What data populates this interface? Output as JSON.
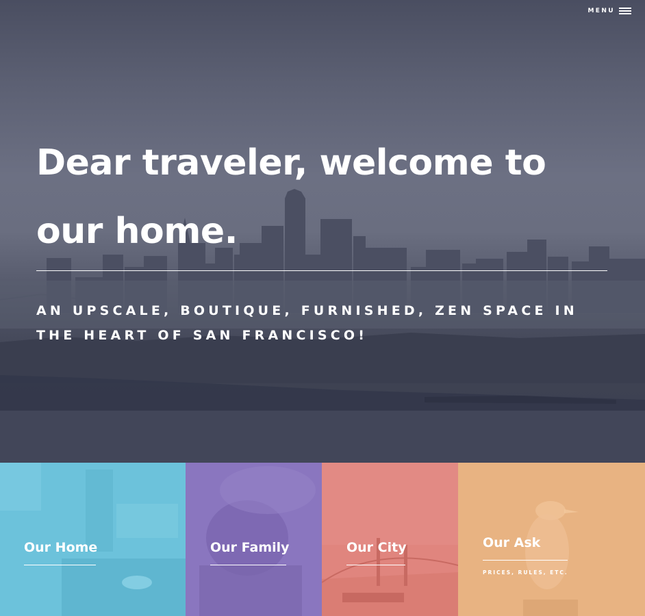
{
  "nav": {
    "menu_label": "MENU",
    "menu_icon": "hamburger-icon"
  },
  "hero": {
    "title": "Dear traveler, welcome to our home.",
    "subtitle": "AN UPSCALE, BOUTIQUE, FURNISHED, ZEN SPACE IN THE HEART OF SAN FRANCISCO!",
    "overlay_color": "#4a4e61"
  },
  "tiles": [
    {
      "title": "Our Home",
      "color": "#6cc2db"
    },
    {
      "title": "Our Family",
      "color": "#8a76bf"
    },
    {
      "title": "Our City",
      "color": "#e0857e"
    },
    {
      "title": "Our Ask",
      "subtitle": "PRICES, RULES, ETC.",
      "color": "#e8b382"
    }
  ]
}
